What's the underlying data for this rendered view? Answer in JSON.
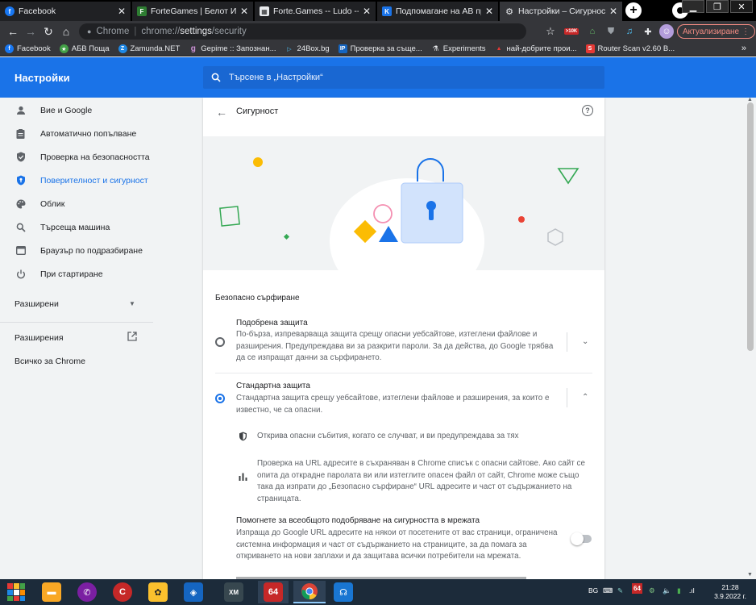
{
  "tabs": [
    {
      "title": "Facebook",
      "icon": "facebook-icon",
      "color": "#1877f2",
      "letter": "f"
    },
    {
      "title": "ForteGames | Белот Играй",
      "icon": "fortegames-icon",
      "color": "#2e7d32",
      "letter": "F"
    },
    {
      "title": "Forte.Games -- Ludo --",
      "icon": "fortegames-ludo-icon",
      "color": "#e8eaed",
      "letter": "▦"
    },
    {
      "title": "Подпомагане на АВ прогр",
      "icon": "av-icon",
      "color": "#1a73e8",
      "letter": "K"
    },
    {
      "title": "Настройки – Сигурност",
      "icon": "settings-gear-icon",
      "color": "#35363a",
      "letter": "⚙"
    }
  ],
  "toolbar": {
    "site_label": "Chrome",
    "url_scheme": "chrome://",
    "url_host": "settings",
    "url_path": "/security",
    "update_label": "Актуализиране",
    "badge_text": ">10K"
  },
  "bookmarks": [
    {
      "label": "Facebook",
      "color": "#1877f2",
      "letter": "f",
      "icon": "facebook-icon"
    },
    {
      "label": "АБВ Поща",
      "color": "#43a047",
      "letter": "★",
      "icon": "abv-mail-icon"
    },
    {
      "label": "Zamunda.NET",
      "color": "#1e88e5",
      "letter": "Z",
      "icon": "zamunda-icon"
    },
    {
      "label": "Gepime :: Запознан...",
      "color": "#8e24aa",
      "letter": "g",
      "icon": "gepime-icon"
    },
    {
      "label": "24Box.bg",
      "color": "#039be5",
      "letter": "▷",
      "icon": "24box-icon"
    },
    {
      "label": "Проверка за съще...",
      "color": "#1565c0",
      "letter": "IP",
      "icon": "ip-check-icon"
    },
    {
      "label": "Experiments",
      "color": "#35363a",
      "letter": "⚗",
      "icon": "experiments-icon"
    },
    {
      "label": "най-добрите прои...",
      "color": "#e53935",
      "letter": "▲",
      "icon": "best-products-icon"
    },
    {
      "label": "Router Scan v2.60 B...",
      "color": "#e53935",
      "letter": "S",
      "icon": "router-scan-icon"
    }
  ],
  "settings_header": {
    "title": "Настройки",
    "search_placeholder": "Търсене в „Настройки“"
  },
  "nav": {
    "items": [
      {
        "label": "Вие и Google",
        "icon": "person-icon"
      },
      {
        "label": "Автоматично попълване",
        "icon": "autofill-icon"
      },
      {
        "label": "Проверка на безопасността",
        "icon": "shield-check-icon"
      },
      {
        "label": "Поверителност и сигурност",
        "icon": "privacy-shield-icon"
      },
      {
        "label": "Облик",
        "icon": "palette-icon"
      },
      {
        "label": "Търсеща машина",
        "icon": "search-icon"
      },
      {
        "label": "Браузър по подразбиране",
        "icon": "browser-icon"
      },
      {
        "label": "При стартиране",
        "icon": "power-icon"
      }
    ],
    "advanced_label": "Разширени",
    "extensions_label": "Разширения",
    "about_label": "Всичко за Chrome"
  },
  "page": {
    "title": "Сигурност",
    "safe_browsing_label": "Безопасно сърфиране",
    "enhanced": {
      "title": "Подобрена защита",
      "desc": "По-бърза, изпреварваща защита срещу опасни уебсайтове, изтеглени файлове и разширения. Предупреждава ви за разкрити пароли. За да действа, до Google трябва да се изпращат данни за сърфирането."
    },
    "standard": {
      "title": "Стандартна защита",
      "desc": "Стандартна защита срещу уебсайтове, изтеглени файлове и разширения, за които е известно, че са опасни."
    },
    "feature1": "Открива опасни събития, когато се случват, и ви предупреждава за тях",
    "feature2": "Проверка на URL адресите в съхраняван в Chrome списък с опасни сайтове. Ако сайт се опита да открадне паролата ви или изтеглите опасен файл от сайт, Chrome може също така да изпрати до „Безопасно сърфиране“ URL адресите и част от съдържанието на страницата.",
    "help_improve": {
      "title": "Помогнете за всеобщото подобряване на сигурността в мрежата",
      "desc": "Изпраща до Google URL адресите на някои от посетените от вас страници, ограничена системна информация и част от съдържанието на страниците, за да помага за откриването на нови заплахи и да защитава всички потребители на мрежата.",
      "enabled": false
    }
  },
  "taskbar": {
    "apps": [
      {
        "icon": "rubiks-cube-icon",
        "color": "#e53935",
        "label": ""
      },
      {
        "icon": "file-explorer-icon",
        "color": "#f9a825",
        "label": ""
      },
      {
        "icon": "viber-icon",
        "color": "#7b1fa2",
        "label": ""
      },
      {
        "icon": "ccleaner-icon",
        "color": "#c62828",
        "label": ""
      },
      {
        "icon": "poe-icon",
        "color": "#fbc02d",
        "label": ""
      },
      {
        "icon": "installer-icon",
        "color": "#1565c0",
        "label": ""
      },
      {
        "icon": "xm-play-icon",
        "color": "#37474f",
        "label": "XM"
      },
      {
        "icon": "64-app-icon",
        "color": "#c62828",
        "label": "64"
      },
      {
        "icon": "chrome-icon",
        "color": "#fbc02d",
        "label": ""
      },
      {
        "icon": "headset-icon",
        "color": "#1976d2",
        "label": ""
      }
    ],
    "lang": "BG",
    "time": "21:28",
    "date": "3.9.2022 г."
  }
}
